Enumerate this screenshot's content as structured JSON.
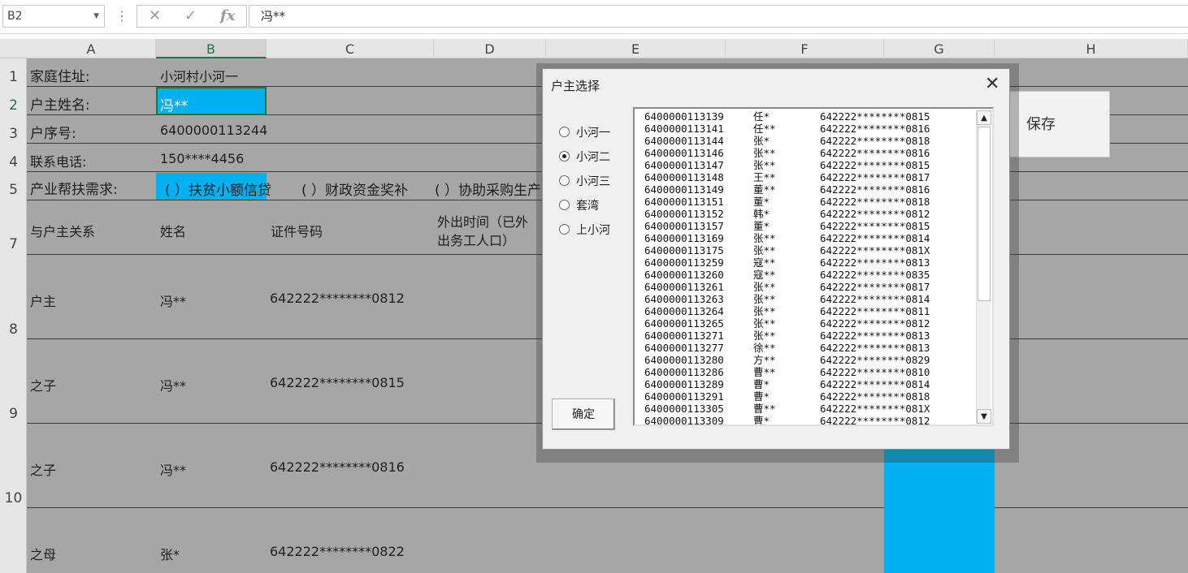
{
  "formula_bar": {
    "name_box": "B2",
    "dots": "⋮",
    "cancel_icon": "✕",
    "enter_icon": "✓",
    "fx_icon": "fx",
    "content": "冯**"
  },
  "columns": [
    "A",
    "B",
    "C",
    "D",
    "E",
    "F",
    "G",
    "H"
  ],
  "rows": [
    "1",
    "2",
    "3",
    "4",
    "5",
    "7",
    "8",
    "9",
    "10"
  ],
  "sheet": {
    "r1": {
      "label": "家庭住址:",
      "value": "小河村小河一"
    },
    "r2": {
      "label": "户主姓名:",
      "value": "冯**"
    },
    "r3": {
      "label": "户序号:",
      "value": "6400000113244"
    },
    "r4": {
      "label": "联系电话:",
      "value": "150****4456"
    },
    "r5": {
      "label": "产业帮扶需求:",
      "opt1": "( ）扶贫小额信贷",
      "opt2": "( ）财政资金奖补",
      "opt3": "( ）协助采购生产"
    },
    "r7": {
      "c1": "与户主关系",
      "c2": "姓名",
      "c3": "证件号码",
      "c4a": "外出时间（已外",
      "c4b": "出务工人口）"
    },
    "members": [
      {
        "relation": "户主",
        "name": "冯**",
        "id": "642222********0812"
      },
      {
        "relation": "之子",
        "name": "冯**",
        "id": "642222********0815"
      },
      {
        "relation": "之子",
        "name": "冯**",
        "id": "642222********0816"
      },
      {
        "relation": "之母",
        "name": "张*",
        "id": "642222********0822"
      }
    ]
  },
  "save_button": "保存",
  "dialog": {
    "title": "户主选择",
    "close": "✕",
    "ok_button": "确定",
    "villages": [
      {
        "label": "小河一",
        "selected": false
      },
      {
        "label": "小河二",
        "selected": true
      },
      {
        "label": "小河三",
        "selected": false
      },
      {
        "label": "套湾",
        "selected": false
      },
      {
        "label": "上小河",
        "selected": false
      }
    ],
    "scroll_up": "▲",
    "scroll_down": "▼",
    "list": [
      {
        "hid": "6400000113139",
        "name": "任*",
        "cert": "642222********0815"
      },
      {
        "hid": "6400000113141",
        "name": "任**",
        "cert": "642222********0816"
      },
      {
        "hid": "6400000113144",
        "name": "张*",
        "cert": "642222********0818"
      },
      {
        "hid": "6400000113146",
        "name": "张**",
        "cert": "642222********0816"
      },
      {
        "hid": "6400000113147",
        "name": "张**",
        "cert": "642222********0815"
      },
      {
        "hid": "6400000113148",
        "name": "王**",
        "cert": "642222********0817"
      },
      {
        "hid": "6400000113149",
        "name": "董**",
        "cert": "642222********0816"
      },
      {
        "hid": "6400000113151",
        "name": "董*",
        "cert": "642222********0818"
      },
      {
        "hid": "6400000113152",
        "name": "韩*",
        "cert": "642222********0812"
      },
      {
        "hid": "6400000113157",
        "name": "董*",
        "cert": "642222********0815"
      },
      {
        "hid": "6400000113169",
        "name": "张**",
        "cert": "642222********0814"
      },
      {
        "hid": "6400000113175",
        "name": "张**",
        "cert": "642222********081X"
      },
      {
        "hid": "6400000113259",
        "name": "寇**",
        "cert": "642222********0813"
      },
      {
        "hid": "6400000113260",
        "name": "寇**",
        "cert": "642222********0835"
      },
      {
        "hid": "6400000113261",
        "name": "张**",
        "cert": "642222********0817"
      },
      {
        "hid": "6400000113263",
        "name": "张**",
        "cert": "642222********0814"
      },
      {
        "hid": "6400000113264",
        "name": "张**",
        "cert": "642222********0811"
      },
      {
        "hid": "6400000113265",
        "name": "张**",
        "cert": "642222********0812"
      },
      {
        "hid": "6400000113271",
        "name": "张**",
        "cert": "642222********0813"
      },
      {
        "hid": "6400000113277",
        "name": "徐**",
        "cert": "642222********0813"
      },
      {
        "hid": "6400000113280",
        "name": "方**",
        "cert": "642222********0829"
      },
      {
        "hid": "6400000113286",
        "name": "曹**",
        "cert": "642222********0810"
      },
      {
        "hid": "6400000113289",
        "name": "曹*",
        "cert": "642222********0814"
      },
      {
        "hid": "6400000113291",
        "name": "曹*",
        "cert": "642222********0818"
      },
      {
        "hid": "6400000113305",
        "name": "曹**",
        "cert": "642222********081X"
      },
      {
        "hid": "6400000113309",
        "name": "曹*",
        "cert": "642222********0812"
      }
    ]
  }
}
